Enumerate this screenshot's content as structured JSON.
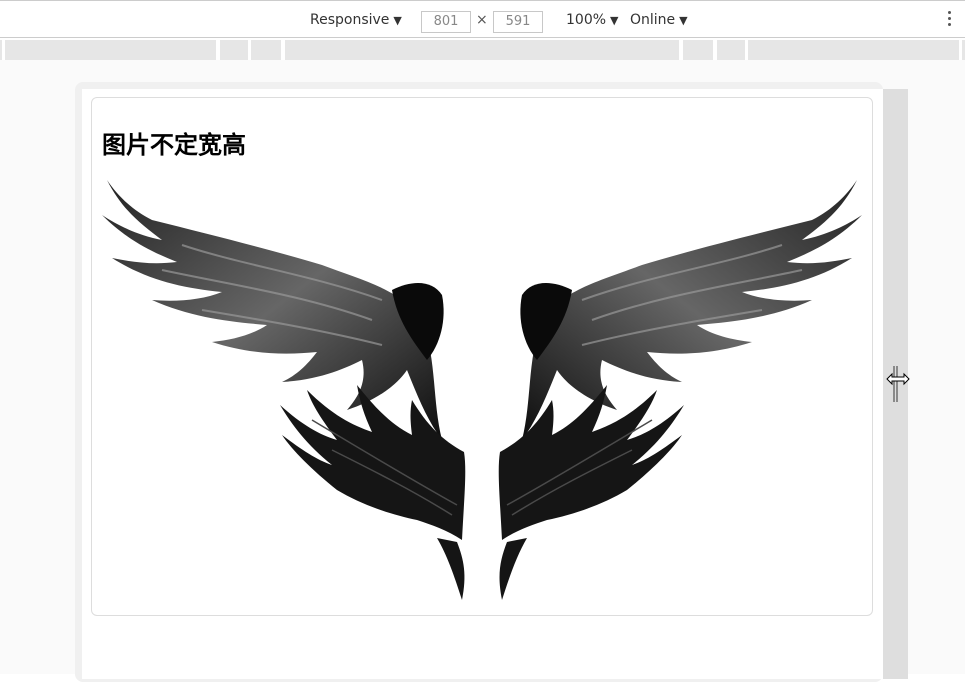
{
  "device_toolbar": {
    "device_mode": "Responsive",
    "width": "801",
    "height": "591",
    "times_symbol": "×",
    "zoom": "100%",
    "throttling": "Online",
    "dropdown_arrow": "▼"
  },
  "page": {
    "title": "图片不定宽高"
  },
  "colors": {
    "wing_dark": "#111111",
    "wing_mid": "#555555",
    "wing_light": "#9a9a9a",
    "card_border": "#dddddd",
    "resize_bar": "#dedede"
  },
  "icons": {
    "menu": "kebab-menu-icon",
    "resize": "resize-horizontal-icon"
  }
}
